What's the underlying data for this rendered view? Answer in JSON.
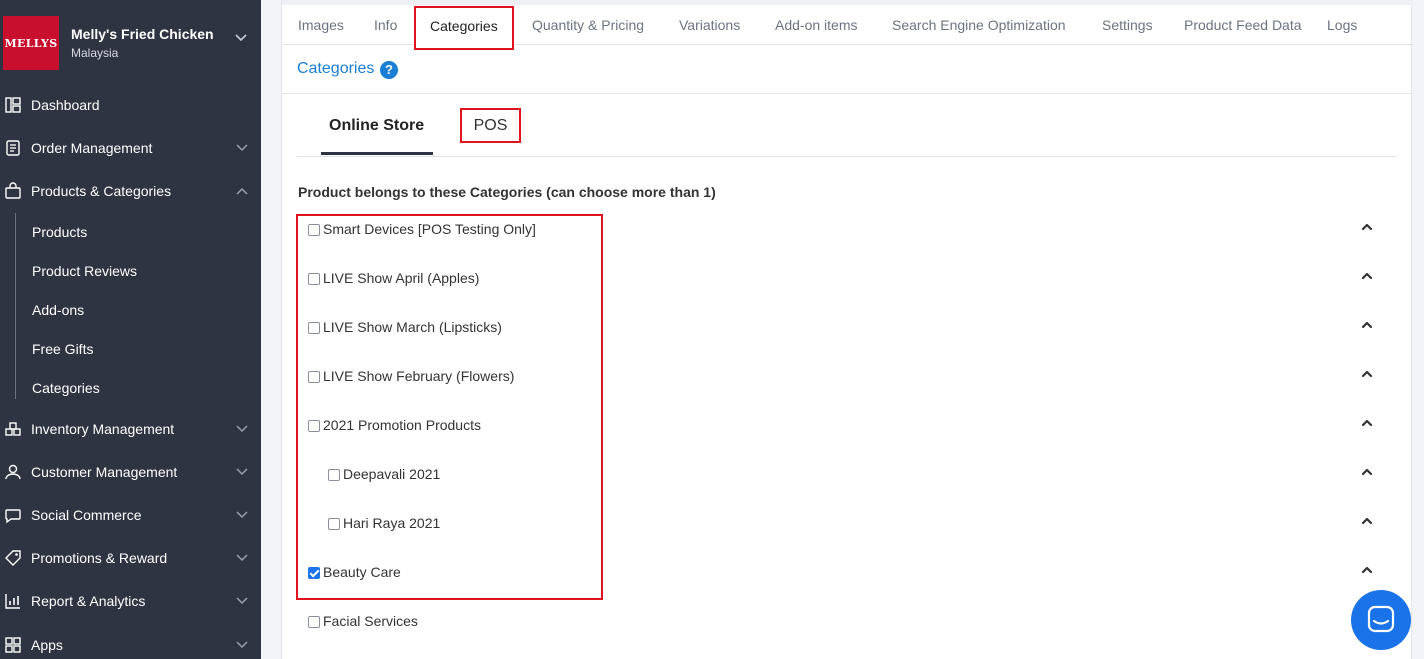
{
  "store": {
    "logo_text": "MELLYS",
    "name": "Melly's Fried Chicken",
    "country": "Malaysia"
  },
  "sidebar": {
    "items": [
      {
        "label": "Dashboard",
        "icon": "dashboard-icon"
      },
      {
        "label": "Order Management",
        "icon": "order-icon"
      },
      {
        "label": "Products & Categories",
        "icon": "bag-icon"
      },
      {
        "label": "Inventory Management",
        "icon": "inventory-icon"
      },
      {
        "label": "Customer Management",
        "icon": "user-icon"
      },
      {
        "label": "Social Commerce",
        "icon": "chat-icon"
      },
      {
        "label": "Promotions & Reward",
        "icon": "tag-icon"
      },
      {
        "label": "Report & Analytics",
        "icon": "chart-icon"
      },
      {
        "label": "Apps",
        "icon": "apps-icon"
      }
    ],
    "subitems": [
      "Products",
      "Product Reviews",
      "Add-ons",
      "Free Gifts",
      "Categories"
    ]
  },
  "tabs": [
    "Images",
    "Info",
    "Categories",
    "Quantity & Pricing",
    "Variations",
    "Add-on items",
    "Search Engine Optimization",
    "Settings",
    "Product Feed Data",
    "Logs"
  ],
  "active_tab": "Categories",
  "section": {
    "title": "Categories",
    "help": "?"
  },
  "subtabs": {
    "online": "Online Store",
    "pos": "POS"
  },
  "category_heading": "Product belongs to these Categories (can choose more than 1)",
  "categories": [
    {
      "label": "Smart Devices [POS Testing Only]",
      "checked": false,
      "level": 0
    },
    {
      "label": "LIVE Show April (Apples)",
      "checked": false,
      "level": 0
    },
    {
      "label": "LIVE Show March (Lipsticks)",
      "checked": false,
      "level": 0
    },
    {
      "label": "LIVE Show February (Flowers)",
      "checked": false,
      "level": 0
    },
    {
      "label": "2021 Promotion Products",
      "checked": false,
      "level": 0
    },
    {
      "label": "Deepavali 2021",
      "checked": false,
      "level": 1
    },
    {
      "label": "Hari Raya 2021",
      "checked": false,
      "level": 1
    },
    {
      "label": "Beauty Care",
      "checked": true,
      "level": 0
    },
    {
      "label": "Facial Services",
      "checked": false,
      "level": 0
    }
  ],
  "colors": {
    "sidebar_bg": "#2f3442",
    "accent_blue": "#1a7fd4",
    "highlight_red": "#e0141e",
    "logo_red": "#c8102e",
    "checkbox_blue": "#1a73e8"
  }
}
